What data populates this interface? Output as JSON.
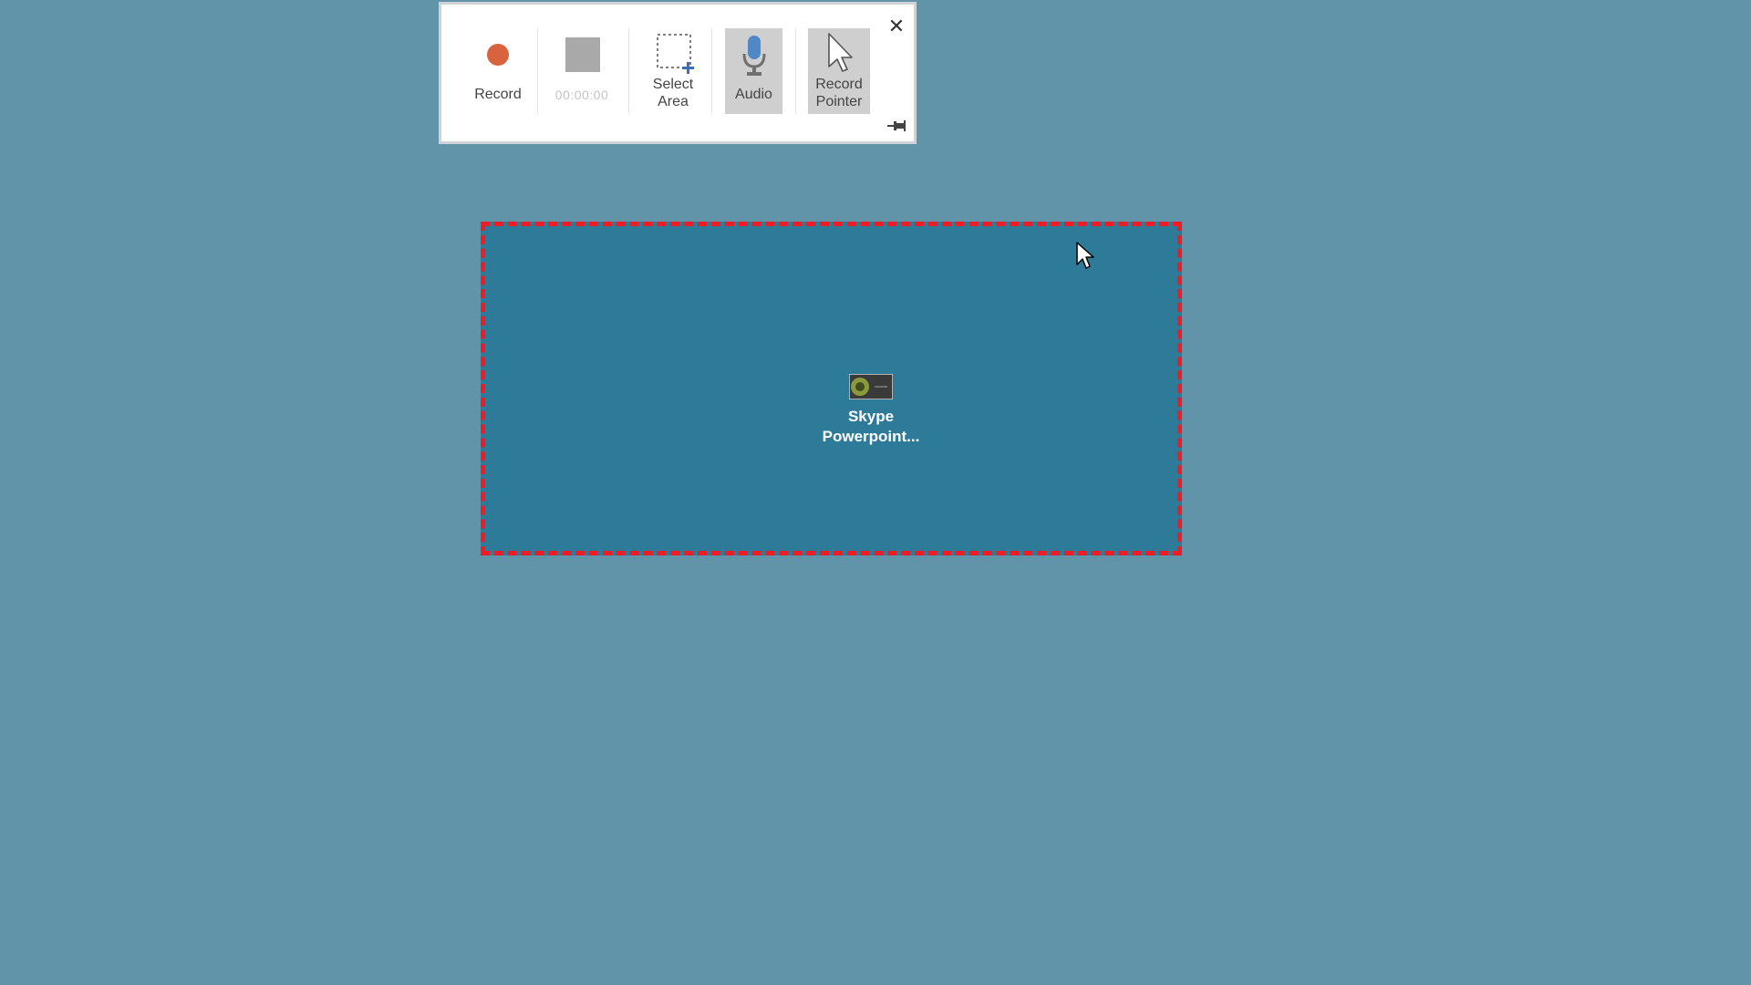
{
  "toolbar": {
    "record_label": "Record",
    "timer_label": "00:00:00",
    "select_area_label": "Select\nArea",
    "audio_label": "Audio",
    "record_pointer_label": "Record\nPointer",
    "close_glyph": "✕",
    "accent_record": "#d9623f",
    "active_toggles": [
      "audio",
      "record-pointer"
    ]
  },
  "selection": {
    "border_color": "#ee1c24",
    "fill_color": "#2e7a99"
  },
  "desktop": {
    "background": "#6194a9",
    "icon": {
      "label": "Skype\nPowerpoint..."
    }
  }
}
